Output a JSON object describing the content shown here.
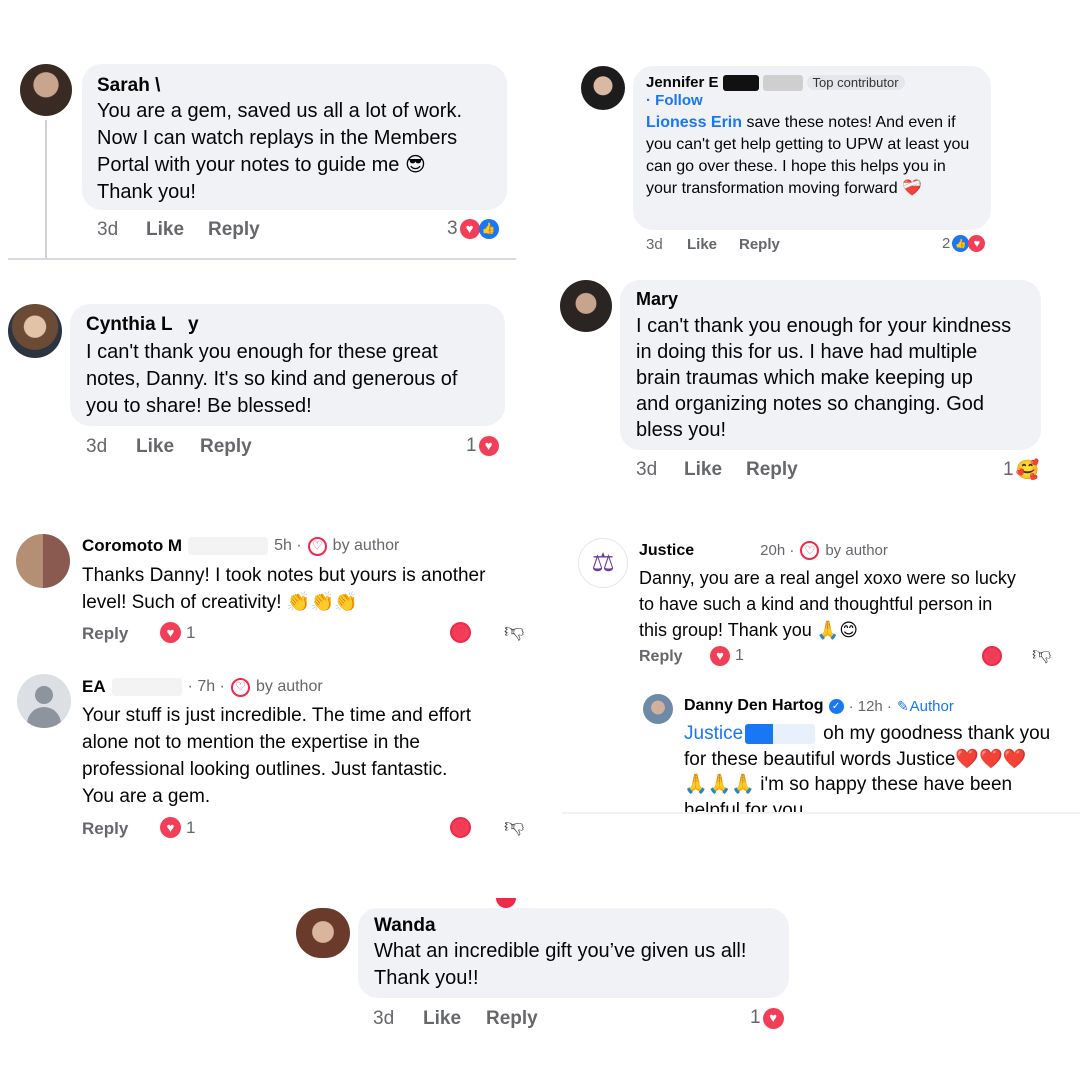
{
  "sarah": {
    "name": "Sarah \\",
    "text": "You are a gem, saved us all a lot of work.\nNow I can watch replays in the Members\nPortal with your notes to guide me 😎\nThank you!",
    "time": "3d",
    "like": "Like",
    "reply": "Reply",
    "count": "3"
  },
  "jennifer": {
    "name": "Jennifer E",
    "badge": "Top contributor",
    "follow": "· Follow",
    "mention": "Lioness Erin",
    "text": " save these notes! And even if you can't get help getting to UPW at least you can go over these. I hope this helps you in your transformation moving forward ❤️‍🩹",
    "time": "3d",
    "like": "Like",
    "reply": "Reply",
    "count": "2"
  },
  "cynthia": {
    "name": "Cynthia L   y",
    "text": "I can't thank you enough for these great\nnotes, Danny. It's so kind and generous of\nyou to share! Be blessed!",
    "time": "3d",
    "like": "Like",
    "reply": "Reply",
    "count": "1"
  },
  "mary": {
    "name": "Mary",
    "text": "I can't thank you enough for your kindness\nin doing this for us.  I have had multiple\nbrain traumas which make keeping up\nand organizing notes so changing.  God\nbless you!",
    "time": "3d",
    "like": "Like",
    "reply": "Reply",
    "count": "1"
  },
  "coromoto": {
    "name": "Coromoto M",
    "time": "5h ·",
    "by": "by author",
    "text": "Thanks Danny! I took notes but yours is another\nlevel! Such of creativity! 👏👏👏",
    "reply": "Reply",
    "count": "1"
  },
  "ea": {
    "name": "EA",
    "time": "· 7h ·",
    "by": "by author",
    "text": "Your stuff is just incredible.  The time and effort\nalone not to mention the expertise in the\nprofessional looking outlines.  Just fantastic.\nYou are a gem.",
    "reply": "Reply",
    "count": "1"
  },
  "justice": {
    "name": "Justice",
    "time": "20h ·",
    "by": "by author",
    "text": "Danny, you are a real angel xoxo were so lucky\nto have such a kind and thoughtful person in\nthis group! Thank you 🙏😊",
    "reply": "Reply",
    "count": "1"
  },
  "danny": {
    "name": "Danny Den Hartog",
    "time": "· 12h ·",
    "author": "Author",
    "mention": "Justice",
    "text1": "oh my goodness thank you",
    "text2": "for these beautiful words Justice❤️❤️❤️",
    "text3": "🙏🙏🙏 i'm so happy these have been",
    "text4": "helpful for you."
  },
  "wanda": {
    "name": "Wanda",
    "text": "What an incredible gift you’ve given us all!\nThank you!!",
    "time": "3d",
    "like": "Like",
    "reply": "Reply",
    "count": "1"
  },
  "icons": {
    "heart": "heart-icon",
    "like": "like-icon",
    "outline": "outline-heart-icon",
    "dislike": "dislike-icon",
    "verified": "verified-icon",
    "pen": "pen-icon"
  },
  "colors": {
    "bubble": "#f0f2f5",
    "link": "#1877f2",
    "love": "#f33e58",
    "meta": "#65676b"
  }
}
